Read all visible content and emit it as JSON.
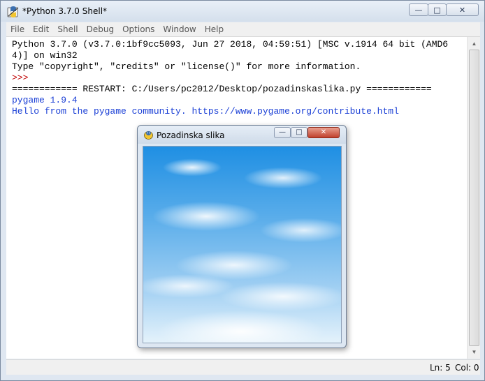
{
  "window": {
    "title": "*Python 3.7.0 Shell*",
    "controls": {
      "minimize": "—",
      "maximize": "□",
      "close": "✕"
    }
  },
  "menubar": {
    "items": [
      "File",
      "Edit",
      "Shell",
      "Debug",
      "Options",
      "Window",
      "Help"
    ]
  },
  "shell": {
    "lines": [
      {
        "text": "Python 3.7.0 (v3.7.0:1bf9cc5093, Jun 27 2018, 04:59:51) [MSC v.1914 64 bit (AMD6",
        "color": "black"
      },
      {
        "text": "4)] on win32",
        "color": "black"
      },
      {
        "text": "Type \"copyright\", \"credits\" or \"license()\" for more information.",
        "color": "black"
      },
      {
        "text": ">>>",
        "color": "red"
      },
      {
        "text": "============ RESTART: C:/Users/pc2012/Desktop/pozadinskaslika.py ============",
        "color": "black"
      },
      {
        "text": "pygame 1.9.4",
        "color": "blue"
      },
      {
        "text": "Hello from the pygame community. https://www.pygame.org/contribute.html",
        "color": "blue"
      }
    ]
  },
  "statusbar": {
    "line": "Ln: 5",
    "col": "Col: 0"
  },
  "pygame_window": {
    "title": "Pozadinska slika",
    "controls": {
      "minimize": "—",
      "maximize": "□",
      "close": "✕"
    },
    "canvas_image": "sky-with-clouds"
  },
  "colors": {
    "output_black": "#000000",
    "prompt_red": "#c00000",
    "stdout_blue": "#1a3fd6"
  },
  "icons": {
    "app": "python-idle-icon",
    "pygame": "pygame-snake-icon"
  }
}
